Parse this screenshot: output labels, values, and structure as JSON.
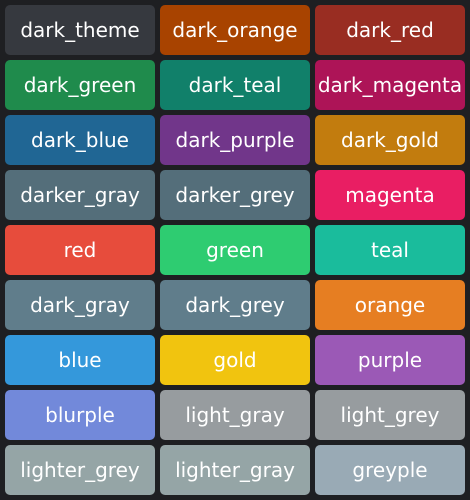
{
  "background": "#1e1f22",
  "swatches": [
    {
      "label": "dark_theme",
      "color": "#36393f"
    },
    {
      "label": "dark_orange",
      "color": "#a84300"
    },
    {
      "label": "dark_red",
      "color": "#992d22"
    },
    {
      "label": "dark_green",
      "color": "#1f8b4c"
    },
    {
      "label": "dark_teal",
      "color": "#11806a"
    },
    {
      "label": "dark_magenta",
      "color": "#ad1457"
    },
    {
      "label": "dark_blue",
      "color": "#206694"
    },
    {
      "label": "dark_purple",
      "color": "#71368a"
    },
    {
      "label": "dark_gold",
      "color": "#c27c0e"
    },
    {
      "label": "darker_gray",
      "color": "#546e7a"
    },
    {
      "label": "darker_grey",
      "color": "#546e7a"
    },
    {
      "label": "magenta",
      "color": "#e91e63"
    },
    {
      "label": "red",
      "color": "#e74c3c"
    },
    {
      "label": "green",
      "color": "#2ecc71"
    },
    {
      "label": "teal",
      "color": "#1abc9c"
    },
    {
      "label": "dark_gray",
      "color": "#607d8b"
    },
    {
      "label": "dark_grey",
      "color": "#607d8b"
    },
    {
      "label": "orange",
      "color": "#e67e22"
    },
    {
      "label": "blue",
      "color": "#3498db"
    },
    {
      "label": "gold",
      "color": "#f1c40f"
    },
    {
      "label": "purple",
      "color": "#9b59b6"
    },
    {
      "label": "blurple",
      "color": "#7289da"
    },
    {
      "label": "light_gray",
      "color": "#979c9f"
    },
    {
      "label": "light_grey",
      "color": "#979c9f"
    },
    {
      "label": "lighter_grey",
      "color": "#95a5a6"
    },
    {
      "label": "lighter_gray",
      "color": "#95a5a6"
    },
    {
      "label": "greyple",
      "color": "#99aab5"
    }
  ]
}
